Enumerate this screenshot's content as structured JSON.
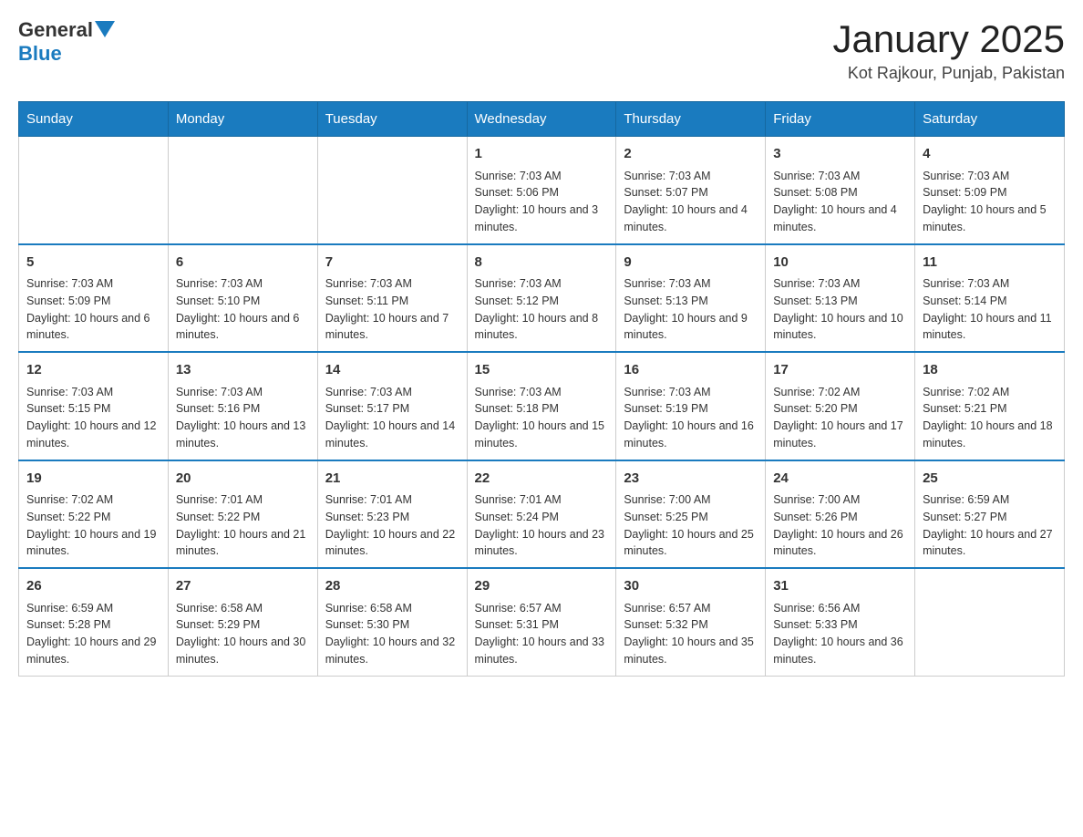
{
  "header": {
    "logo": {
      "general": "General",
      "blue": "Blue"
    },
    "title": "January 2025",
    "location": "Kot Rajkour, Punjab, Pakistan"
  },
  "weekdays": [
    "Sunday",
    "Monday",
    "Tuesday",
    "Wednesday",
    "Thursday",
    "Friday",
    "Saturday"
  ],
  "weeks": [
    [
      {
        "day": "",
        "info": ""
      },
      {
        "day": "",
        "info": ""
      },
      {
        "day": "",
        "info": ""
      },
      {
        "day": "1",
        "info": "Sunrise: 7:03 AM\nSunset: 5:06 PM\nDaylight: 10 hours and 3 minutes."
      },
      {
        "day": "2",
        "info": "Sunrise: 7:03 AM\nSunset: 5:07 PM\nDaylight: 10 hours and 4 minutes."
      },
      {
        "day": "3",
        "info": "Sunrise: 7:03 AM\nSunset: 5:08 PM\nDaylight: 10 hours and 4 minutes."
      },
      {
        "day": "4",
        "info": "Sunrise: 7:03 AM\nSunset: 5:09 PM\nDaylight: 10 hours and 5 minutes."
      }
    ],
    [
      {
        "day": "5",
        "info": "Sunrise: 7:03 AM\nSunset: 5:09 PM\nDaylight: 10 hours and 6 minutes."
      },
      {
        "day": "6",
        "info": "Sunrise: 7:03 AM\nSunset: 5:10 PM\nDaylight: 10 hours and 6 minutes."
      },
      {
        "day": "7",
        "info": "Sunrise: 7:03 AM\nSunset: 5:11 PM\nDaylight: 10 hours and 7 minutes."
      },
      {
        "day": "8",
        "info": "Sunrise: 7:03 AM\nSunset: 5:12 PM\nDaylight: 10 hours and 8 minutes."
      },
      {
        "day": "9",
        "info": "Sunrise: 7:03 AM\nSunset: 5:13 PM\nDaylight: 10 hours and 9 minutes."
      },
      {
        "day": "10",
        "info": "Sunrise: 7:03 AM\nSunset: 5:13 PM\nDaylight: 10 hours and 10 minutes."
      },
      {
        "day": "11",
        "info": "Sunrise: 7:03 AM\nSunset: 5:14 PM\nDaylight: 10 hours and 11 minutes."
      }
    ],
    [
      {
        "day": "12",
        "info": "Sunrise: 7:03 AM\nSunset: 5:15 PM\nDaylight: 10 hours and 12 minutes."
      },
      {
        "day": "13",
        "info": "Sunrise: 7:03 AM\nSunset: 5:16 PM\nDaylight: 10 hours and 13 minutes."
      },
      {
        "day": "14",
        "info": "Sunrise: 7:03 AM\nSunset: 5:17 PM\nDaylight: 10 hours and 14 minutes."
      },
      {
        "day": "15",
        "info": "Sunrise: 7:03 AM\nSunset: 5:18 PM\nDaylight: 10 hours and 15 minutes."
      },
      {
        "day": "16",
        "info": "Sunrise: 7:03 AM\nSunset: 5:19 PM\nDaylight: 10 hours and 16 minutes."
      },
      {
        "day": "17",
        "info": "Sunrise: 7:02 AM\nSunset: 5:20 PM\nDaylight: 10 hours and 17 minutes."
      },
      {
        "day": "18",
        "info": "Sunrise: 7:02 AM\nSunset: 5:21 PM\nDaylight: 10 hours and 18 minutes."
      }
    ],
    [
      {
        "day": "19",
        "info": "Sunrise: 7:02 AM\nSunset: 5:22 PM\nDaylight: 10 hours and 19 minutes."
      },
      {
        "day": "20",
        "info": "Sunrise: 7:01 AM\nSunset: 5:22 PM\nDaylight: 10 hours and 21 minutes."
      },
      {
        "day": "21",
        "info": "Sunrise: 7:01 AM\nSunset: 5:23 PM\nDaylight: 10 hours and 22 minutes."
      },
      {
        "day": "22",
        "info": "Sunrise: 7:01 AM\nSunset: 5:24 PM\nDaylight: 10 hours and 23 minutes."
      },
      {
        "day": "23",
        "info": "Sunrise: 7:00 AM\nSunset: 5:25 PM\nDaylight: 10 hours and 25 minutes."
      },
      {
        "day": "24",
        "info": "Sunrise: 7:00 AM\nSunset: 5:26 PM\nDaylight: 10 hours and 26 minutes."
      },
      {
        "day": "25",
        "info": "Sunrise: 6:59 AM\nSunset: 5:27 PM\nDaylight: 10 hours and 27 minutes."
      }
    ],
    [
      {
        "day": "26",
        "info": "Sunrise: 6:59 AM\nSunset: 5:28 PM\nDaylight: 10 hours and 29 minutes."
      },
      {
        "day": "27",
        "info": "Sunrise: 6:58 AM\nSunset: 5:29 PM\nDaylight: 10 hours and 30 minutes."
      },
      {
        "day": "28",
        "info": "Sunrise: 6:58 AM\nSunset: 5:30 PM\nDaylight: 10 hours and 32 minutes."
      },
      {
        "day": "29",
        "info": "Sunrise: 6:57 AM\nSunset: 5:31 PM\nDaylight: 10 hours and 33 minutes."
      },
      {
        "day": "30",
        "info": "Sunrise: 6:57 AM\nSunset: 5:32 PM\nDaylight: 10 hours and 35 minutes."
      },
      {
        "day": "31",
        "info": "Sunrise: 6:56 AM\nSunset: 5:33 PM\nDaylight: 10 hours and 36 minutes."
      },
      {
        "day": "",
        "info": ""
      }
    ]
  ]
}
